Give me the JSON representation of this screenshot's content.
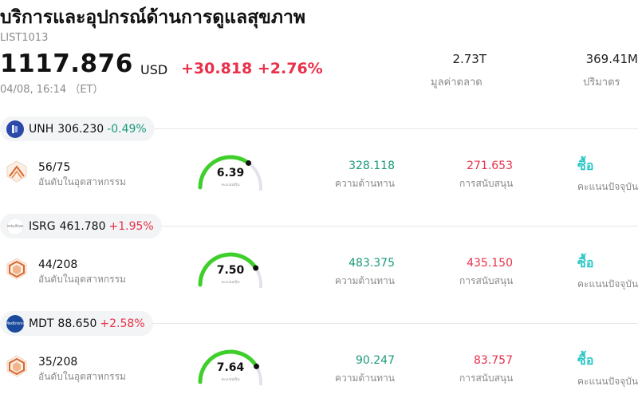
{
  "header": {
    "title": "บริการและอุปกรณ์ด้านการดูแลสุขภาพ",
    "code": "LIST1013",
    "price": "1117.876",
    "currency": "USD",
    "change": "+30.818",
    "change_pct": "+2.76%",
    "datetime": "04/08, 16:14 （ET）",
    "market_cap": {
      "value": "2.73T",
      "label": "มูลค่าตลาด"
    },
    "volume": {
      "value": "369.41M",
      "label": "ปริมาตร"
    }
  },
  "colors": {
    "up": "#e8304a",
    "down": "#1a9a7a",
    "rating": "#2cc6c6",
    "gauge": "#3ecf2a"
  },
  "rows": [
    {
      "symbol": "UNH",
      "price": "306.230",
      "change_pct": "-0.49%",
      "direction": "down",
      "logo": "unh-logo",
      "logo_text": "",
      "rank": "56/75",
      "rank_label": "อันดับในอุตสาหกรรม",
      "score": "6.39",
      "score_label": "คะแนนหุ้น",
      "score_fraction": 0.639,
      "resistance": "328.118",
      "resistance_label": "ความต้านทาน",
      "support": "271.653",
      "support_label": "การสนับสนุน",
      "rating": "ซื้อ",
      "rating_label": "คะแนนปัจจุบัน"
    },
    {
      "symbol": "ISRG",
      "price": "461.780",
      "change_pct": "+1.95%",
      "direction": "up",
      "logo": "isrg-logo",
      "logo_text": "intuitive",
      "rank": "44/208",
      "rank_label": "อันดับในอุตสาหกรรม",
      "score": "7.50",
      "score_label": "คะแนนหุ้น",
      "score_fraction": 0.75,
      "resistance": "483.375",
      "resistance_label": "ความต้านทาน",
      "support": "435.150",
      "support_label": "การสนับสนุน",
      "rating": "ซื้อ",
      "rating_label": "คะแนนปัจจุบัน"
    },
    {
      "symbol": "MDT",
      "price": "88.650",
      "change_pct": "+2.58%",
      "direction": "up",
      "logo": "mdt-logo",
      "logo_text": "Medtronic",
      "rank": "35/208",
      "rank_label": "อันดับในอุตสาหกรรม",
      "score": "7.64",
      "score_label": "คะแนนหุ้น",
      "score_fraction": 0.764,
      "resistance": "90.247",
      "resistance_label": "ความต้านทาน",
      "support": "83.757",
      "support_label": "การสนับสนุน",
      "rating": "ซื้อ",
      "rating_label": "คะแนนปัจจุบัน"
    }
  ]
}
